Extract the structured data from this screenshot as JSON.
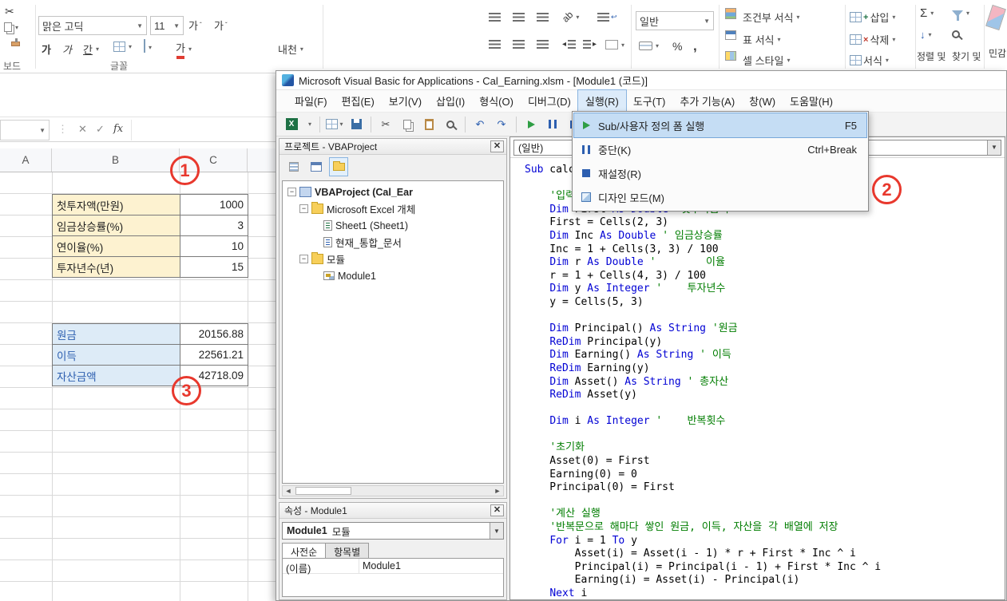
{
  "colors": {
    "keyword_blue": "#0000d4",
    "comment_green": "#007d00",
    "annotation_red": "#e8382d",
    "menu_highlight": "#c5ddf4",
    "input_label_fill": "#fdf2d0",
    "result_label_fill": "#ddebf7"
  },
  "excel": {
    "ribbon": {
      "font_name": "맑은 고딕",
      "font_size": "11",
      "bold": "가",
      "italic": "가",
      "underline": "간",
      "grow_font": "가",
      "shrink_font": "가",
      "font_color": "가",
      "phonetic": "내천",
      "number_format": "일반",
      "percent": "%",
      "comma": ",",
      "autosum": "Σ",
      "conditional_format": "조건부 서식",
      "format_as_table": "표 서식",
      "cell_styles": "셀 스타일",
      "insert": "삽입",
      "delete": "삭제",
      "format": "서식",
      "sort": "정렬 및",
      "find": "찾기 및",
      "sensitivity": "민감",
      "clipboard_group": "보드",
      "font_group": "글꼴"
    },
    "sheet": {
      "columns": [
        "A",
        "B",
        "C"
      ],
      "input_table": {
        "rows": [
          {
            "label": "첫투자액(만원)",
            "value": "1000"
          },
          {
            "label": "임금상승률(%)",
            "value": "3"
          },
          {
            "label": "연이율(%)",
            "value": "10"
          },
          {
            "label": "투자년수(년)",
            "value": "15"
          }
        ]
      },
      "result_table": {
        "rows": [
          {
            "label": "원금",
            "value": "20156.88"
          },
          {
            "label": "이득",
            "value": "22561.21"
          },
          {
            "label": "자산금액",
            "value": "42718.09"
          }
        ]
      }
    },
    "annotations": [
      "1",
      "2",
      "3"
    ]
  },
  "vba": {
    "title": "Microsoft Visual Basic for Applications - Cal_Earning.xlsm - [Module1 (코드)]",
    "menu": [
      "파일(F)",
      "편집(E)",
      "보기(V)",
      "삽입(I)",
      "형식(O)",
      "디버그(D)",
      "실행(R)",
      "도구(T)",
      "추가 기능(A)",
      "창(W)",
      "도움말(H)"
    ],
    "open_menu": "실행(R)",
    "run_menu": [
      {
        "label": "Sub/사용자 정의 폼 실행",
        "shortcut": "F5",
        "icon": "run",
        "highlighted": true
      },
      {
        "label": "중단(K)",
        "shortcut": "Ctrl+Break",
        "icon": "break",
        "highlighted": false
      },
      {
        "label": "재설정(R)",
        "shortcut": "",
        "icon": "reset",
        "highlighted": false
      },
      {
        "label": "디자인 모드(M)",
        "shortcut": "",
        "icon": "design",
        "highlighted": false
      }
    ],
    "project_panel": {
      "title": "프로젝트 - VBAProject",
      "tree": [
        {
          "label": "VBAProject (Cal_Ear",
          "depth": 0,
          "icon": "project",
          "expander": true,
          "bold": true
        },
        {
          "label": "Microsoft Excel 개체",
          "depth": 1,
          "icon": "folder",
          "expander": true,
          "bold": false
        },
        {
          "label": "Sheet1 (Sheet1)",
          "depth": 2,
          "icon": "sheet",
          "expander": false,
          "bold": false
        },
        {
          "label": "현재_통합_문서",
          "depth": 2,
          "icon": "workbook",
          "expander": false,
          "bold": false
        },
        {
          "label": "모듈",
          "depth": 1,
          "icon": "folder",
          "expander": true,
          "bold": false
        },
        {
          "label": "Module1",
          "depth": 2,
          "icon": "module",
          "expander": false,
          "bold": false
        }
      ]
    },
    "properties_panel": {
      "title": "속성 - Module1",
      "object_name": "Module1",
      "object_type": "모듈",
      "tabs": [
        "사전순",
        "항목별"
      ],
      "grid": [
        {
          "name": "(이름)",
          "value": "Module1"
        }
      ]
    },
    "code_window": {
      "object_combo": "(일반)",
      "code_lines": [
        "Sub calculator()",
        "",
        "    '입력",
        "    Dim First As Double '첫투자금액",
        "    First = Cells(2, 3)",
        "    Dim Inc As Double ' 임금상승률",
        "    Inc = 1 + Cells(3, 3) / 100",
        "    Dim r As Double '        이율",
        "    r = 1 + Cells(4, 3) / 100",
        "    Dim y As Integer '    투자년수",
        "    y = Cells(5, 3)",
        "",
        "    Dim Principal() As String '원금",
        "    ReDim Principal(y)",
        "    Dim Earning() As String ' 이득",
        "    ReDim Earning(y)",
        "    Dim Asset() As String ' 총자산",
        "    ReDim Asset(y)",
        "",
        "    Dim i As Integer '    반복횟수",
        "",
        "    '초기화",
        "    Asset(0) = First",
        "    Earning(0) = 0",
        "    Principal(0) = First",
        "",
        "    '계산 실행",
        "    '반복문으로 해마다 쌓인 원금, 이득, 자산을 각 배열에 저장",
        "    For i = 1 To y",
        "        Asset(i) = Asset(i - 1) * r + First * Inc ^ i",
        "        Principal(i) = Principal(i - 1) + First * Inc ^ i",
        "        Earning(i) = Asset(i) - Principal(i)",
        "    Next i"
      ]
    }
  }
}
